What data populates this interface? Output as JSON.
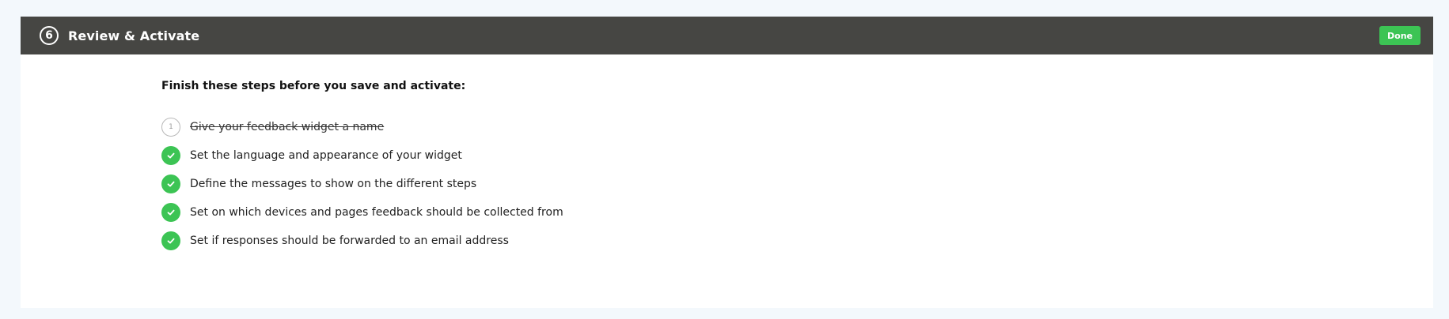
{
  "header": {
    "step_number": "6",
    "title": "Review & Activate",
    "done_label": "Done"
  },
  "intro": "Finish these steps before you save and activate:",
  "steps": [
    {
      "badge": "1",
      "text": "Give your feedback widget a name",
      "status": "pending-struck"
    },
    {
      "badge": "",
      "text": "Set the language and appearance of your widget",
      "status": "done"
    },
    {
      "badge": "",
      "text": "Define the messages to show on the different steps",
      "status": "done"
    },
    {
      "badge": "",
      "text": "Set on which devices and pages feedback should be collected from",
      "status": "done"
    },
    {
      "badge": "",
      "text": "Set if responses should be forwarded to an email address",
      "status": "done"
    }
  ],
  "colors": {
    "header_bg": "#464643",
    "accent_green": "#3cc454",
    "page_bg": "#f3f8fc"
  },
  "icons": {
    "done": "checkmark-icon"
  }
}
